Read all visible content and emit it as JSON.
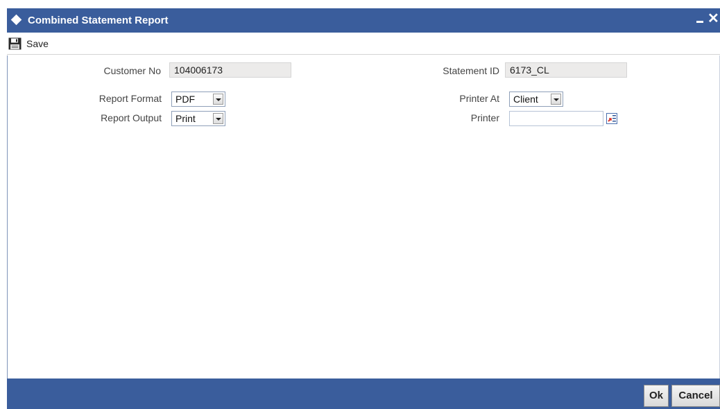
{
  "window": {
    "title": "Combined Statement Report",
    "title_icon": "diamond-icon",
    "minimize_icon": "minimize-icon",
    "close_icon": "close-icon",
    "bar_color": "#3a5d9c"
  },
  "toolbar": {
    "save_label": "Save",
    "save_icon": "floppy-disk-icon"
  },
  "form": {
    "customer_no": {
      "label": "Customer No",
      "value": "104006173"
    },
    "statement_id": {
      "label": "Statement ID",
      "value": "6173_CL"
    },
    "report_format": {
      "label": "Report Format",
      "value": "PDF"
    },
    "printer_at": {
      "label": "Printer At",
      "value": "Client"
    },
    "report_output": {
      "label": "Report Output",
      "value": "Print"
    },
    "printer": {
      "label": "Printer",
      "value": "",
      "lov_icon": "list-of-values-icon"
    }
  },
  "footer": {
    "ok_label": "Ok",
    "cancel_label": "Cancel"
  }
}
